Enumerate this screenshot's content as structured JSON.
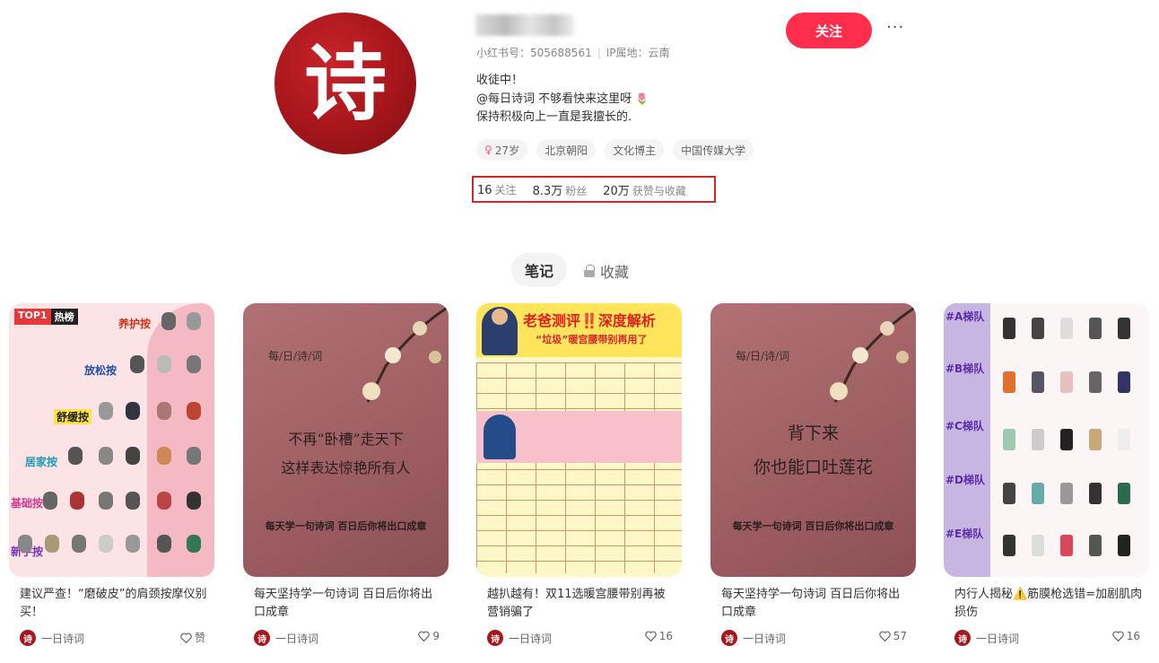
{
  "profile": {
    "avatar_char": "诗",
    "id_label": "小红书号：505688561",
    "ip_label": "IP属地：云南",
    "bio": [
      "收徒中！",
      "@每日诗词 不够看快来这里呀",
      "保持积极向上一直是我擅长的."
    ],
    "bio_emoji": "🌷",
    "tags": [
      "27岁",
      "北京朝阳",
      "文化博主",
      "中国传媒大学"
    ],
    "stats": [
      {
        "value": "16",
        "label": "关注"
      },
      {
        "value": "8.3万",
        "label": "粉丝"
      },
      {
        "value": "20万",
        "label": "获赞与收藏"
      }
    ],
    "follow_label": "关注",
    "more_label": "···"
  },
  "tabs": {
    "notes": "笔记",
    "collect": "收藏"
  },
  "cards": [
    {
      "title": "建议严查！“磨破皮”的肩颈按摩仪别买！",
      "author": "一日诗词",
      "likes": "赞"
    },
    {
      "title": "每天坚持学一句诗词 百日后你将出口成章",
      "author": "一日诗词",
      "likes": "9"
    },
    {
      "title": "越扒越有！双11选暖宫腰带别再被营销骗了",
      "author": "一日诗词",
      "likes": "16"
    },
    {
      "title": "每天坚持学一句诗词 百日后你将出口成章",
      "author": "一日诗词",
      "likes": "57"
    },
    {
      "title": "内行人揭秘⚠️筋膜枪选错=加剧肌肉损伤",
      "author": "一日诗词",
      "likes": "16"
    }
  ],
  "covers": {
    "c1": {
      "top1": "TOP1",
      "hot": "热榜",
      "cats": [
        "养护按",
        "放松按",
        "舒缓按",
        "居家按",
        "基础按",
        "新手按"
      ]
    },
    "c2": {
      "head": "每/日/诗/词",
      "lines": [
        "不再“卧槽”走天下",
        "这样表达惊艳所有人"
      ],
      "foot": "每天学一句诗词 百日后你将出口成章"
    },
    "c3": {
      "t1": "老爸测评‼️深度解析",
      "t2": "“垃圾”暖宫腰带别再用了"
    },
    "c4": {
      "head": "每/日/诗/词",
      "lines": [
        "背下来",
        "你也能口吐莲花"
      ],
      "foot": "每天学一句诗词 百日后你将出口成章"
    },
    "c5": {
      "ranks": [
        "#A梯队",
        "#B梯队",
        "#C梯队",
        "#D梯队",
        "#E梯队"
      ]
    }
  },
  "colors": {
    "accent": "#ff2e4d",
    "avatar": "#a8161c",
    "highlight": "#c92a2a"
  }
}
